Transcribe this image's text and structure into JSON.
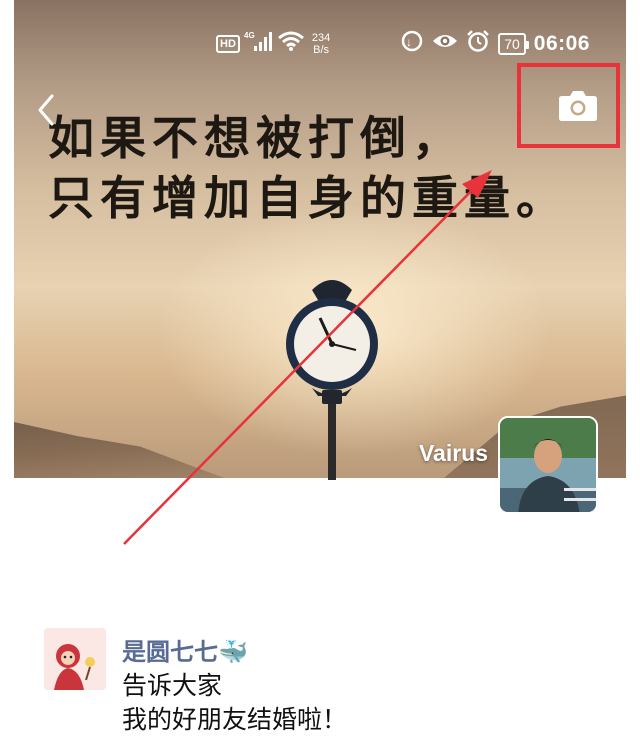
{
  "status_bar": {
    "hd_label": "HD",
    "network_label": "4G",
    "net_speed_value": "234",
    "net_speed_unit": "B/s",
    "battery_level": "70",
    "time": "06:06"
  },
  "cover": {
    "quote_line1": "如果不想被打倒，",
    "quote_line2": "只有增加自身的重量。"
  },
  "profile": {
    "username": "Vairus"
  },
  "feed": [
    {
      "author": "是圆七七",
      "author_emoji": "🐳",
      "text_line1": "告诉大家",
      "text_line2": "我的好朋友结婚啦！"
    }
  ],
  "colors": {
    "highlight": "#e8333a",
    "name_link": "#576b95"
  },
  "icons": {
    "back": "chevron-left-icon",
    "camera": "camera-icon",
    "wifi": "wifi-icon",
    "signal": "signal-icon",
    "eye": "eye-icon",
    "alarm": "alarm-icon",
    "data_saver": "data-saver-icon"
  }
}
